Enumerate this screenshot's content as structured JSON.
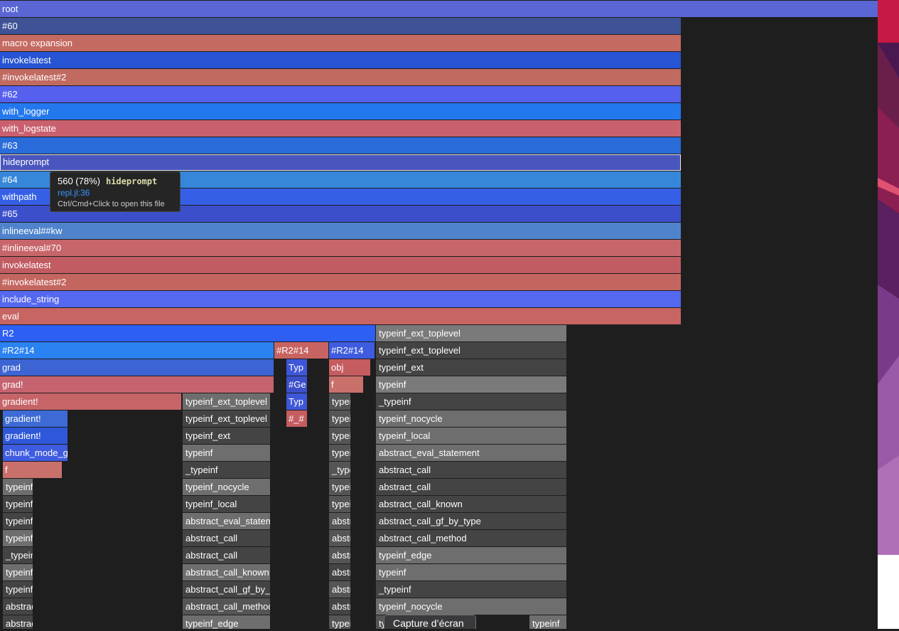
{
  "colors": {
    "white": "#ffffff"
  },
  "frames": [
    {
      "label": "root",
      "color": "#5a66d4"
    },
    {
      "label": "#60",
      "color": "#3f5295"
    },
    {
      "label": "macro expansion",
      "color": "#c56a61"
    },
    {
      "label": "invokelatest",
      "color": "#2654d3"
    },
    {
      "label": "#invokelatest#2",
      "color": "#c06a60"
    },
    {
      "label": "#62",
      "color": "#5660ee"
    },
    {
      "label": "with_logger",
      "color": "#2478ee"
    },
    {
      "label": "with_logstate",
      "color": "#c9606e"
    },
    {
      "label": "#63",
      "color": "#2a6cd9"
    },
    {
      "label": "hideprompt",
      "color": "#4a56be",
      "selected": true
    },
    {
      "label": "#64",
      "color": "#3687d9"
    },
    {
      "label": "withpath",
      "color": "#3560e6"
    },
    {
      "label": "#65",
      "color": "#3c4fcb"
    },
    {
      "label": "inlineeval##kw",
      "color": "#4f84cc"
    },
    {
      "label": "#inlineeval#70",
      "color": "#c7666a"
    },
    {
      "label": "invokelatest",
      "color": "#c15c63"
    },
    {
      "label": "#invokelatest#2",
      "color": "#c46660"
    },
    {
      "label": "include_string",
      "color": "#5568f0"
    },
    {
      "label": "eval",
      "color": "#c76562"
    },
    {
      "label": "R2",
      "color": "#2d5ff2"
    },
    {
      "label": "typeinf_ext_toplevel",
      "color": "#7a7a7a"
    },
    {
      "label": "#R2#14",
      "color": "#2b82f1"
    },
    {
      "label": "#R2#14",
      "color": "#c76462"
    },
    {
      "label": "#R2#14",
      "color": "#3f5ce0"
    },
    {
      "label": "typeinf_ext_toplevel",
      "color": "#444444"
    },
    {
      "label": "grad",
      "color": "#3d64d3"
    },
    {
      "label": "Typ",
      "color": "#3e56d8"
    },
    {
      "label": "obj",
      "color": "#c55c60"
    },
    {
      "label": "typeinf_ext",
      "color": "#444444"
    },
    {
      "label": "grad!",
      "color": "#c5636e"
    },
    {
      "label": "#Ge",
      "color": "#3c4fcb"
    },
    {
      "label": "f",
      "color": "#c9706b"
    },
    {
      "label": "typeinf",
      "color": "#7a7a7a"
    },
    {
      "label": "gradient!",
      "color": "#c66468"
    },
    {
      "label": "typeinf_ext_toplevel",
      "color": "#6e6e6e"
    },
    {
      "label": "Typ",
      "color": "#3e56d8"
    },
    {
      "label": "typeinf",
      "color": "#555555"
    },
    {
      "label": "_typeinf",
      "color": "#444444"
    },
    {
      "label": "gradient!",
      "color": "#3d6ad4"
    },
    {
      "label": "typeinf_ext_toplevel",
      "color": "#444444"
    },
    {
      "label": "#_#",
      "color": "#c55c60"
    },
    {
      "label": "typeinf",
      "color": "#555555"
    },
    {
      "label": "typeinf_nocycle",
      "color": "#6e6e6e"
    },
    {
      "label": "gradient!",
      "color": "#2e58d9"
    },
    {
      "label": "typeinf_ext",
      "color": "#444444"
    },
    {
      "label": "typeinf",
      "color": "#555555"
    },
    {
      "label": "typeinf_local",
      "color": "#6e6e6e"
    },
    {
      "label": "chunk_mode_gradient!",
      "color": "#3f5ce0"
    },
    {
      "label": "typeinf",
      "color": "#6e6e6e"
    },
    {
      "label": "typeinf",
      "color": "#555555"
    },
    {
      "label": "abstract_eval_statement",
      "color": "#6e6e6e"
    },
    {
      "label": "f",
      "color": "#c9706b"
    },
    {
      "label": "_typeinf",
      "color": "#444444"
    },
    {
      "label": "_typeinf",
      "color": "#555555"
    },
    {
      "label": "abstract_call",
      "color": "#444444"
    },
    {
      "label": "typeinf",
      "color": "#6e6e6e"
    },
    {
      "label": "typeinf_nocycle",
      "color": "#6e6e6e"
    },
    {
      "label": "typeinf_nocycle",
      "color": "#555555"
    },
    {
      "label": "abstract_call",
      "color": "#444444"
    },
    {
      "label": "typeinf",
      "color": "#444444"
    },
    {
      "label": "typeinf_local",
      "color": "#444444"
    },
    {
      "label": "typeinf_local",
      "color": "#555555"
    },
    {
      "label": "abstract_call_known",
      "color": "#444444"
    },
    {
      "label": "typeinf",
      "color": "#444444"
    },
    {
      "label": "abstract_eval_statement",
      "color": "#6e6e6e"
    },
    {
      "label": "abstract_eval_statement",
      "color": "#555555"
    },
    {
      "label": "abstract_call_gf_by_type",
      "color": "#444444"
    },
    {
      "label": "typeinf",
      "color": "#6e6e6e"
    },
    {
      "label": "abstract_call",
      "color": "#444444"
    },
    {
      "label": "abstract_call",
      "color": "#555555"
    },
    {
      "label": "abstract_call_method",
      "color": "#444444"
    },
    {
      "label": "_typeinf",
      "color": "#444444"
    },
    {
      "label": "abstract_call",
      "color": "#444444"
    },
    {
      "label": "abstract_call",
      "color": "#555555"
    },
    {
      "label": "typeinf_edge",
      "color": "#6e6e6e"
    },
    {
      "label": "typeinf",
      "color": "#6e6e6e"
    },
    {
      "label": "abstract_call_known",
      "color": "#6e6e6e"
    },
    {
      "label": "abstract_call",
      "color": "#444444"
    },
    {
      "label": "typeinf",
      "color": "#6e6e6e"
    },
    {
      "label": "typeinf",
      "color": "#444444"
    },
    {
      "label": "abstract_call_gf_by_type",
      "color": "#444444"
    },
    {
      "label": "abstract_call",
      "color": "#555555"
    },
    {
      "label": "_typeinf",
      "color": "#444444"
    },
    {
      "label": "abstract_call",
      "color": "#444444"
    },
    {
      "label": "abstract_call_method",
      "color": "#555555"
    },
    {
      "label": "abstract_call",
      "color": "#444444"
    },
    {
      "label": "typeinf_nocycle",
      "color": "#6e6e6e"
    },
    {
      "label": "abstract_call",
      "color": "#444444"
    },
    {
      "label": "typeinf_edge",
      "color": "#6e6e6e"
    },
    {
      "label": "typeinf",
      "color": "#555555"
    },
    {
      "label": "typeinf",
      "color": "#555555"
    },
    {
      "label": "typeinf",
      "color": "#6e6e6e"
    }
  ],
  "tooltip": {
    "count": "560 (78%)",
    "function": "hideprompt",
    "location": "repl.jl:36",
    "hint": "Ctrl/Cmd+Click to open this file"
  },
  "capture": {
    "label": "Capture d’écran"
  }
}
